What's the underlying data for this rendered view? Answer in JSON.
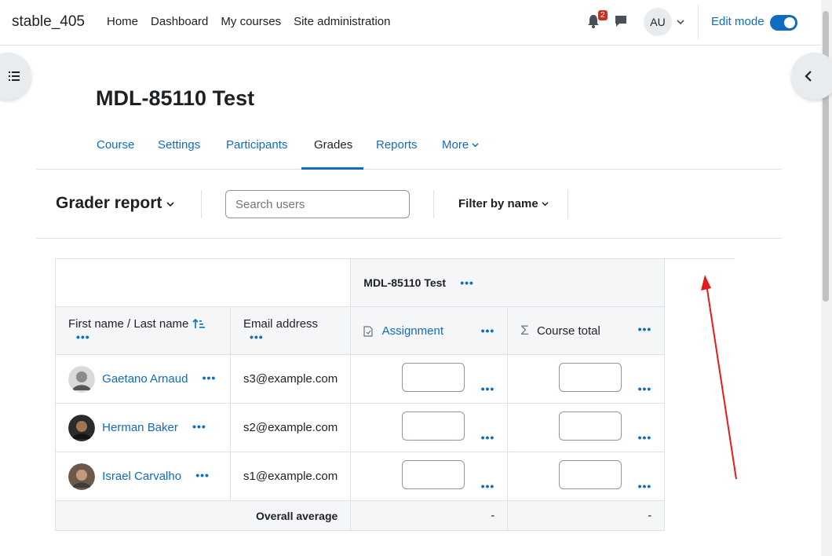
{
  "site": {
    "name": "stable_405"
  },
  "nav": {
    "items": [
      "Home",
      "Dashboard",
      "My courses",
      "Site administration"
    ]
  },
  "header": {
    "notification_count": "2",
    "avatar_initials": "AU",
    "edit_mode_label": "Edit mode",
    "edit_mode_on": true
  },
  "course": {
    "title": "MDL-85110 Test"
  },
  "secondary_nav": {
    "tabs": [
      "Course",
      "Settings",
      "Participants",
      "Grades",
      "Reports",
      "More"
    ],
    "active": "Grades"
  },
  "report": {
    "title": "Grader report",
    "search_placeholder": "Search users",
    "filter_label": "Filter by name"
  },
  "table": {
    "category_header": "MDL-85110 Test",
    "col_name": "First name / Last name",
    "col_email": "Email address",
    "col_assignment": "Assignment",
    "col_total": "Course total",
    "rows": [
      {
        "name": "Gaetano Arnaud",
        "email": "s3@example.com"
      },
      {
        "name": "Herman Baker",
        "email": "s2@example.com"
      },
      {
        "name": "Israel Carvalho",
        "email": "s1@example.com"
      }
    ],
    "overall_label": "Overall average",
    "overall_assignment": "-",
    "overall_total": "-"
  },
  "colors": {
    "primary": "#0f6cbf",
    "badge": "#ca3120",
    "annotation_arrow": "#e31b1b"
  },
  "icons": [
    "bell-icon",
    "message-icon",
    "chevron-down-icon",
    "index-drawer-icon",
    "chevron-left-icon",
    "sort-asc-icon",
    "assignment-icon",
    "sigma-icon",
    "more-icon"
  ]
}
